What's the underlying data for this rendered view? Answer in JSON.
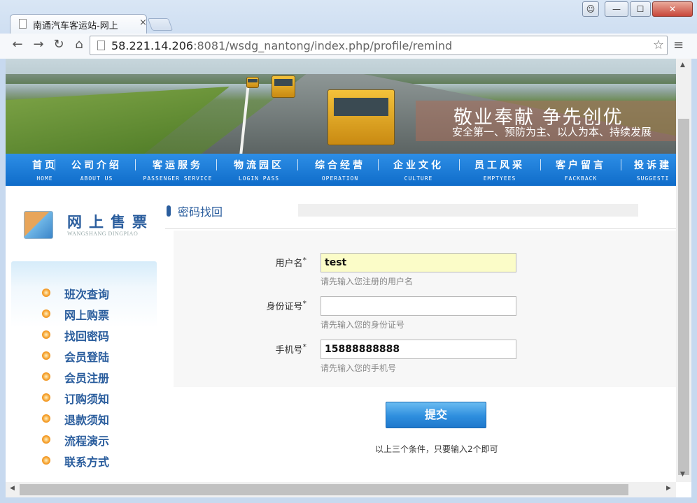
{
  "browser": {
    "tab_title": "南通汽车客运站-网上",
    "tab_close": "×",
    "url_host": "58.221.14.206",
    "url_rest": ":8081/wsdg_nantong/index.php/profile/remind",
    "star_icon": "☆",
    "menu_icon": "≡",
    "back_icon": "←",
    "forward_icon": "→",
    "reload_icon": "↻",
    "home_icon": "⌂",
    "win_user_icon": "user-icon",
    "win_min": "—",
    "win_max": "☐",
    "win_close": "✕"
  },
  "banner": {
    "slogan_main": "敬业奉献  争先创优",
    "slogan_sub": "安全第一、预防为主、以人为本、持续发展"
  },
  "nav": {
    "items": [
      {
        "cn": "首页",
        "en": "HOME"
      },
      {
        "cn": "公司介绍",
        "en": "ABOUT US"
      },
      {
        "cn": "客运服务",
        "en": "PASSENGER SERVICE"
      },
      {
        "cn": "物流园区",
        "en": "LOGIN PASS"
      },
      {
        "cn": "综合经营",
        "en": "OPERATION"
      },
      {
        "cn": "企业文化",
        "en": "CULTURE"
      },
      {
        "cn": "员工风采",
        "en": "EMPTYEES"
      },
      {
        "cn": "客户留言",
        "en": "FACKBACK"
      },
      {
        "cn": "投诉建",
        "en": "SUGGESTI"
      }
    ]
  },
  "sidebar": {
    "title": "网上售票",
    "subtitle": "WANGSHANG DINGPIAO",
    "items": [
      {
        "label": "班次查询"
      },
      {
        "label": "网上购票"
      },
      {
        "label": "找回密码"
      },
      {
        "label": "会员登陆"
      },
      {
        "label": "会员注册"
      },
      {
        "label": "订购须知"
      },
      {
        "label": "退款须知"
      },
      {
        "label": "流程演示"
      },
      {
        "label": "联系方式"
      }
    ]
  },
  "main": {
    "section_title": "密码找回",
    "form": {
      "username_label": "用户名",
      "username_value": "test",
      "username_hint": "请先输入您注册的用户名",
      "idcard_label": "身份证号",
      "idcard_value": "",
      "idcard_hint": "请先输入您的身份证号",
      "phone_label": "手机号",
      "phone_value": "15888888888",
      "phone_hint": "请先输入您的手机号",
      "required_mark": "*"
    },
    "submit_label": "提交",
    "note": "以上三个条件，只要输入2个即可"
  },
  "colors": {
    "accent": "#2a5d9d",
    "nav_bg": "#1777d6",
    "input_filled": "#fbfcc8",
    "button": "#2e8ede"
  }
}
